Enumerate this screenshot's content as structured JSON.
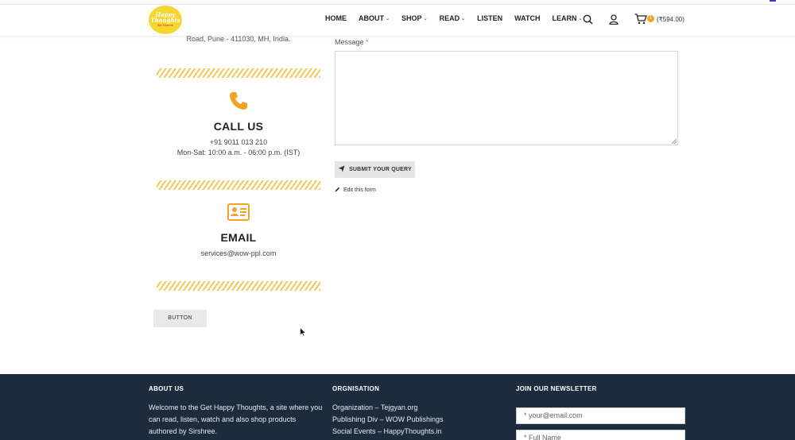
{
  "header": {
    "logo": {
      "line1": "Happy",
      "line2": "Thoughts",
      "line3": "We Nurture"
    },
    "nav": [
      {
        "label": "HOME",
        "dropdown": false
      },
      {
        "label": "ABOUT",
        "dropdown": true
      },
      {
        "label": "SHOP",
        "dropdown": true
      },
      {
        "label": "READ",
        "dropdown": true
      },
      {
        "label": "LISTEN",
        "dropdown": false
      },
      {
        "label": "WATCH",
        "dropdown": false
      },
      {
        "label": "LEARN",
        "dropdown": true
      }
    ],
    "cart": {
      "count": "1",
      "total": "(₹594.00)"
    }
  },
  "contact": {
    "address_tail": "Road, Pune - 411030, MH, India.",
    "call": {
      "title": "CALL US",
      "phone": "+91 9011 013 210",
      "hours": "Mon-Sat: 10:00 a.m. - 06:00 p.m. (IST)"
    },
    "email": {
      "title": "EMAIL",
      "address": "services@wow-ppl.com"
    },
    "button_label": "BUTTON"
  },
  "form": {
    "message_label": "Message",
    "required_mark": "*",
    "message_value": "",
    "submit_label": "SUBMIT YOUR QUERY",
    "edit_label": "Edit this form"
  },
  "footer": {
    "about": {
      "heading": "ABOUT US",
      "text": "Welcome to the Get Happy Thoughts, a site where you can read, listen, watch and also shop products authored by Sirshree."
    },
    "organisation": {
      "heading": "ORGNISATION",
      "links": [
        "Organization – Tejgyan.org",
        "Publishing Div – WOW Publishings",
        "Social Events – HappyThoughts.in"
      ]
    },
    "newsletter": {
      "heading": "JOIN OUR NEWSLETTER",
      "email_placeholder": "* your@email.com",
      "name_placeholder": "* Full Name"
    }
  },
  "colors": {
    "accent": "#f2a224",
    "footer_bg": "#1d2c3c",
    "stripe": "#f0c85a"
  }
}
